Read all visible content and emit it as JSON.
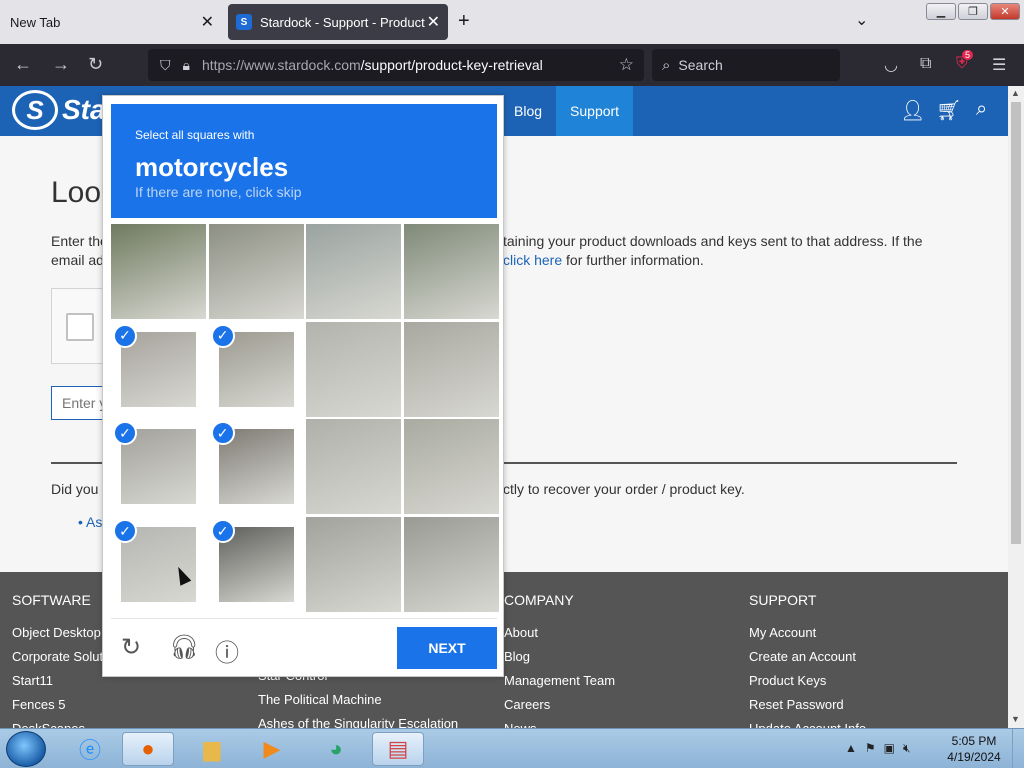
{
  "browser": {
    "tabs": [
      {
        "title": "New Tab",
        "active": false
      },
      {
        "title": "Stardock - Support - Product Key",
        "active": true
      }
    ],
    "url_domain": "https://www.stardock.com",
    "url_path": "/support/product-key-retrieval",
    "search_placeholder": "Search",
    "badge_count": "5"
  },
  "site": {
    "logo_text": "Star",
    "nav": [
      "Blog",
      "Support"
    ],
    "page_title": "Loo",
    "intro_left": "Enter the email ad",
    "intro_right_1": "taining your product downloads and keys sent to that address. If the",
    "intro_right_link": "click here",
    "intro_right_2": " for further information.",
    "email_placeholder": "Enter y",
    "didyou_left": "Did you",
    "didyou_right": "ctly to recover your order / product key.",
    "bullet": "• As",
    "footer": {
      "col1": {
        "heading": "SOFTWARE",
        "links": [
          "Object Desktop",
          "Corporate Solutio",
          "Start11",
          "Fences 5",
          "DeskScapes"
        ]
      },
      "col2": {
        "links": [
          "Star Control",
          "The Political Machine",
          "Ashes of the Singularity Escalation"
        ]
      },
      "col3": {
        "heading": "COMPANY",
        "links": [
          "About",
          "Blog",
          "Management Team",
          "Careers",
          "News"
        ]
      },
      "col4": {
        "heading": "SUPPORT",
        "links": [
          "My Account",
          "Create an Account",
          "Product Keys",
          "Reset Password",
          "Update Account Info"
        ]
      }
    }
  },
  "captcha": {
    "line1": "Select all squares with",
    "target": "motorcycles",
    "line3": "If there are none, click skip",
    "next_label": "NEXT",
    "cells": [
      {
        "selected": false,
        "bg": "#6f7a5f"
      },
      {
        "selected": false,
        "bg": "#8c8f82"
      },
      {
        "selected": false,
        "bg": "#9aa3a0"
      },
      {
        "selected": false,
        "bg": "#7f8a78"
      },
      {
        "selected": true,
        "bg": "#a6a39c"
      },
      {
        "selected": true,
        "bg": "#9c9a90"
      },
      {
        "selected": false,
        "bg": "#b3b3ad"
      },
      {
        "selected": false,
        "bg": "#a8a8a0"
      },
      {
        "selected": true,
        "bg": "#a2a19c"
      },
      {
        "selected": true,
        "bg": "#7e7b74"
      },
      {
        "selected": false,
        "bg": "#b0b0aa"
      },
      {
        "selected": false,
        "bg": "#a9aaa0"
      },
      {
        "selected": true,
        "bg": "#b5b5b2"
      },
      {
        "selected": true,
        "bg": "#5f5f5c"
      },
      {
        "selected": false,
        "bg": "#a2a29d"
      },
      {
        "selected": false,
        "bg": "#9a9a94"
      }
    ]
  },
  "taskbar": {
    "time": "5:05 PM",
    "date": "4/19/2024"
  },
  "colors": {
    "accent": "#1a73e8",
    "site_header": "#1d63b5",
    "footer": "#555555"
  }
}
